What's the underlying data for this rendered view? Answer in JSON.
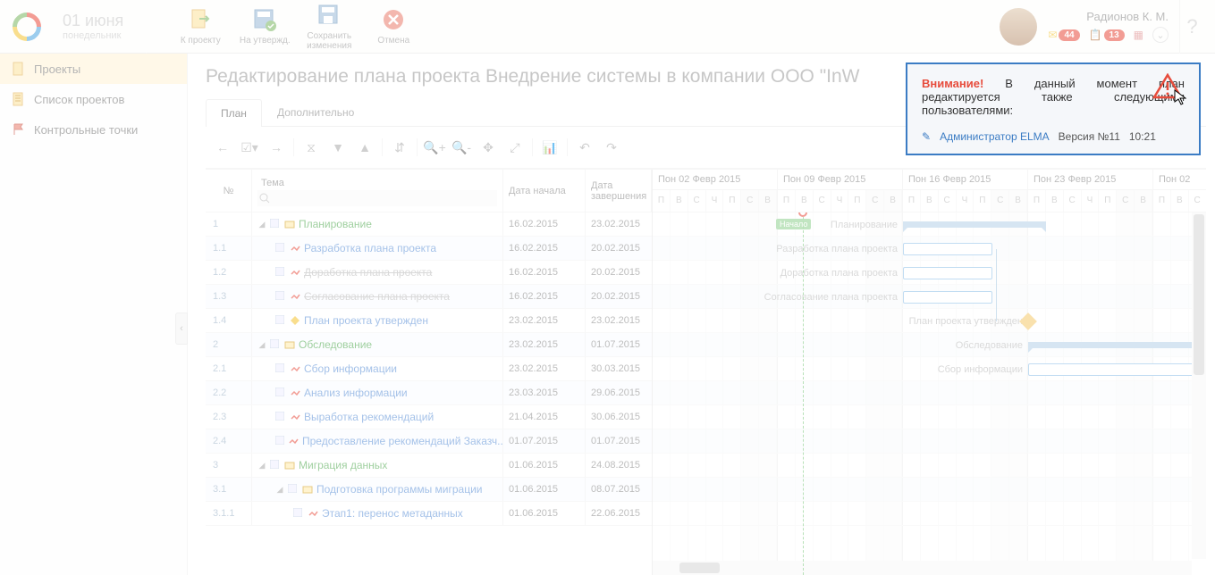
{
  "header": {
    "date_day": "01 июня",
    "date_weekday": "понедельник",
    "ribbon": {
      "to_project": "К проекту",
      "to_approve": "На утвержд.",
      "save": "Сохранить изменения",
      "cancel": "Отмена"
    },
    "user_name": "Радионов К. М.",
    "counter1": "44",
    "counter2": "13",
    "help": "?"
  },
  "sidebar": {
    "items": [
      {
        "label": "Проекты"
      },
      {
        "label": "Список проектов"
      },
      {
        "label": "Контрольные точки"
      }
    ]
  },
  "page": {
    "title": "Редактирование плана проекта Внедрение системы в компании ООО \"InW",
    "tabs": {
      "plan": "План",
      "extra": "Дополнительно"
    }
  },
  "grid": {
    "col_num": "№",
    "col_theme": "Тема",
    "search_placeholder": "",
    "col_start": "Дата начала",
    "col_end": "Дата завершения",
    "rows": [
      {
        "num": "1",
        "text": "Планирование",
        "start": "16.02.2015",
        "end": "23.02.2015",
        "lvl": 0,
        "kind": "summary"
      },
      {
        "num": "1.1",
        "text": "Разработка плана проекта",
        "start": "16.02.2015",
        "end": "20.02.2015",
        "lvl": 1,
        "kind": "task"
      },
      {
        "num": "1.2",
        "text": "Доработка плана проекта",
        "start": "16.02.2015",
        "end": "20.02.2015",
        "lvl": 1,
        "kind": "task",
        "strike": true
      },
      {
        "num": "1.3",
        "text": "Согласование плана проекта",
        "start": "16.02.2015",
        "end": "20.02.2015",
        "lvl": 1,
        "kind": "task",
        "strike": true
      },
      {
        "num": "1.4",
        "text": "План проекта утвержден",
        "start": "23.02.2015",
        "end": "23.02.2015",
        "lvl": 1,
        "kind": "milestone"
      },
      {
        "num": "2",
        "text": "Обследование",
        "start": "23.02.2015",
        "end": "01.07.2015",
        "lvl": 0,
        "kind": "summary"
      },
      {
        "num": "2.1",
        "text": "Сбор информации",
        "start": "23.02.2015",
        "end": "30.03.2015",
        "lvl": 1,
        "kind": "task"
      },
      {
        "num": "2.2",
        "text": "Анализ информации",
        "start": "23.03.2015",
        "end": "29.06.2015",
        "lvl": 1,
        "kind": "task"
      },
      {
        "num": "2.3",
        "text": "Выработка рекомендаций",
        "start": "21.04.2015",
        "end": "30.06.2015",
        "lvl": 1,
        "kind": "task"
      },
      {
        "num": "2.4",
        "text": "Предоставление рекомендаций Заказч...",
        "start": "01.07.2015",
        "end": "01.07.2015",
        "lvl": 1,
        "kind": "task"
      },
      {
        "num": "3",
        "text": "Миграция данных",
        "start": "01.06.2015",
        "end": "24.08.2015",
        "lvl": 0,
        "kind": "summary"
      },
      {
        "num": "3.1",
        "text": "Подготовка программы миграции",
        "start": "01.06.2015",
        "end": "08.07.2015",
        "lvl": 1,
        "kind": "summary"
      },
      {
        "num": "3.1.1",
        "text": "Этап1: перенос метаданных",
        "start": "01.06.2015",
        "end": "22.06.2015",
        "lvl": 2,
        "kind": "task"
      }
    ]
  },
  "timeline": {
    "weeks": [
      "Пон 02 Февр 2015",
      "Пон 09 Февр 2015",
      "Пон 16 Февр 2015",
      "Пон 23 Февр 2015",
      "Пон 02"
    ],
    "days": [
      "П",
      "В",
      "С",
      "Ч",
      "П",
      "С",
      "В"
    ],
    "start_flag": "Начало",
    "bar_labels": {
      "r0": "Планирование",
      "r1": "Разработка плана проекта",
      "r2": "Доработка плана проекта",
      "r3": "Согласование плана проекта",
      "r4": "План проекта утвержден",
      "r5": "Обследование",
      "r6": "Сбор информации"
    }
  },
  "popup": {
    "attention": "Внимание!",
    "body": "В данный момент план редактируется также следующими пользователями:",
    "user": "Администратор ELMA",
    "version": "Версия №11",
    "time": "10:21"
  }
}
